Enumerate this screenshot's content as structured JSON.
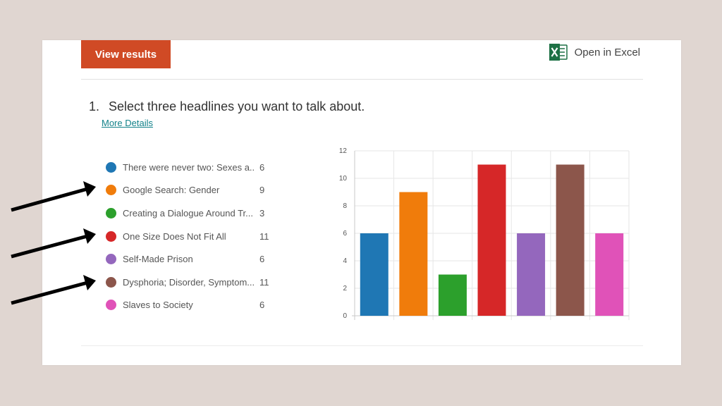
{
  "header": {
    "view_results_label": "View results",
    "open_excel_label": "Open in Excel",
    "excel_icon": "excel-icon"
  },
  "question": {
    "number": "1.",
    "text": "Select three headlines you want to talk about.",
    "details_link": "More Details"
  },
  "legend": [
    {
      "label": "There were never two: Sexes a...",
      "count": "6",
      "color": "#1f77b4"
    },
    {
      "label": "Google Search: Gender",
      "count": "9",
      "color": "#f07c0b"
    },
    {
      "label": "Creating a Dialogue Around Tr...",
      "count": "3",
      "color": "#2ca02c"
    },
    {
      "label": "One Size Does Not Fit All",
      "count": "11",
      "color": "#d62728"
    },
    {
      "label": "Self-Made Prison",
      "count": "6",
      "color": "#9467bd"
    },
    {
      "label": "Dysphoria; Disorder, Symptom...",
      "count": "11",
      "color": "#8c564b"
    },
    {
      "label": "Slaves to Society",
      "count": "6",
      "color": "#e052b8"
    }
  ],
  "chart_data": {
    "type": "bar",
    "categories": [
      "There were never two: Sexes a...",
      "Google Search: Gender",
      "Creating a Dialogue Around Tr...",
      "One Size Does Not Fit All",
      "Self-Made Prison",
      "Dysphoria; Disorder, Symptom...",
      "Slaves to Society"
    ],
    "values": [
      6,
      9,
      3,
      11,
      6,
      11,
      6
    ],
    "colors": [
      "#1f77b4",
      "#f07c0b",
      "#2ca02c",
      "#d62728",
      "#9467bd",
      "#8c564b",
      "#e052b8"
    ],
    "ylim": [
      0,
      12
    ],
    "yticks": [
      "0",
      "2",
      "4",
      "6",
      "8",
      "10",
      "12"
    ],
    "grid": true,
    "legend_placement": "left"
  },
  "annotations": {
    "arrow_color": "#000000",
    "arrow_targets": [
      "Google Search: Gender",
      "One Size Does Not Fit All",
      "Dysphoria; Disorder, Symptom..."
    ]
  }
}
